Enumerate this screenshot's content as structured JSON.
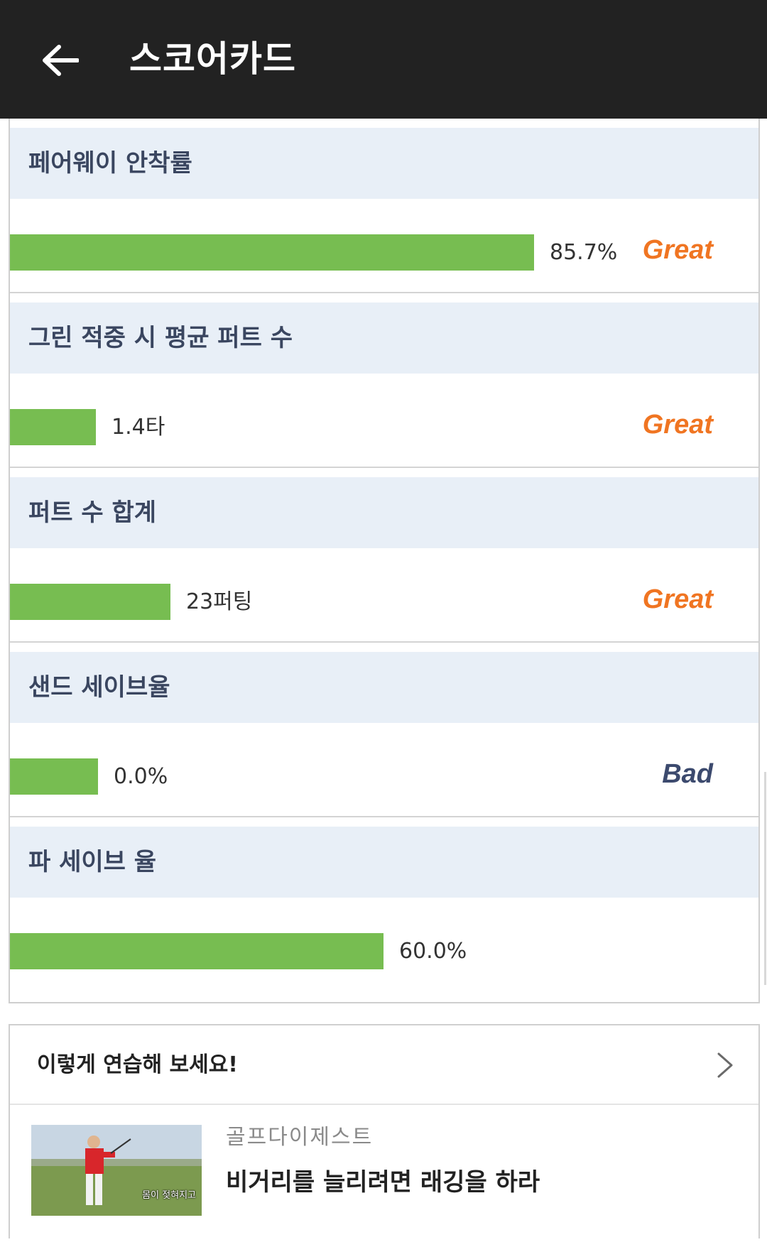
{
  "header": {
    "title": "스코어카드",
    "back_icon": "arrow-left-icon"
  },
  "stats": [
    {
      "name": "페어웨이 안착률",
      "value": "85.7%",
      "bar_percent": 85.7,
      "rating": "Great",
      "rating_color": "#f07522"
    },
    {
      "name": "그린 적중 시 평균 퍼트 수",
      "value": "1.4타",
      "bar_percent": 14,
      "rating": "Great",
      "rating_color": "#f07522"
    },
    {
      "name": "퍼트 수 합계",
      "value": "23퍼팅",
      "bar_percent": 26,
      "rating": "Great",
      "rating_color": "#f07522"
    },
    {
      "name": "샌드 세이브율",
      "value": "0.0%",
      "bar_percent": 14.3,
      "rating": "Bad",
      "rating_color": "#3c4a6e"
    },
    {
      "name": "파 세이브 율",
      "value": "60.0%",
      "bar_percent": 61,
      "rating": "",
      "rating_color": "#f07522"
    }
  ],
  "practice": {
    "title": "이렇게 연습해 보세요!",
    "chevron_icon": "chevron-right-icon",
    "article": {
      "source": "골프다이제스트",
      "title": "비거리를 늘리려면 래깅을 하라",
      "thumbnail_caption": "몸이 젖혀지고"
    }
  },
  "colors": {
    "bar": "#77bd51",
    "header_bg": "#222222",
    "section_bg": "#e8eff7"
  }
}
